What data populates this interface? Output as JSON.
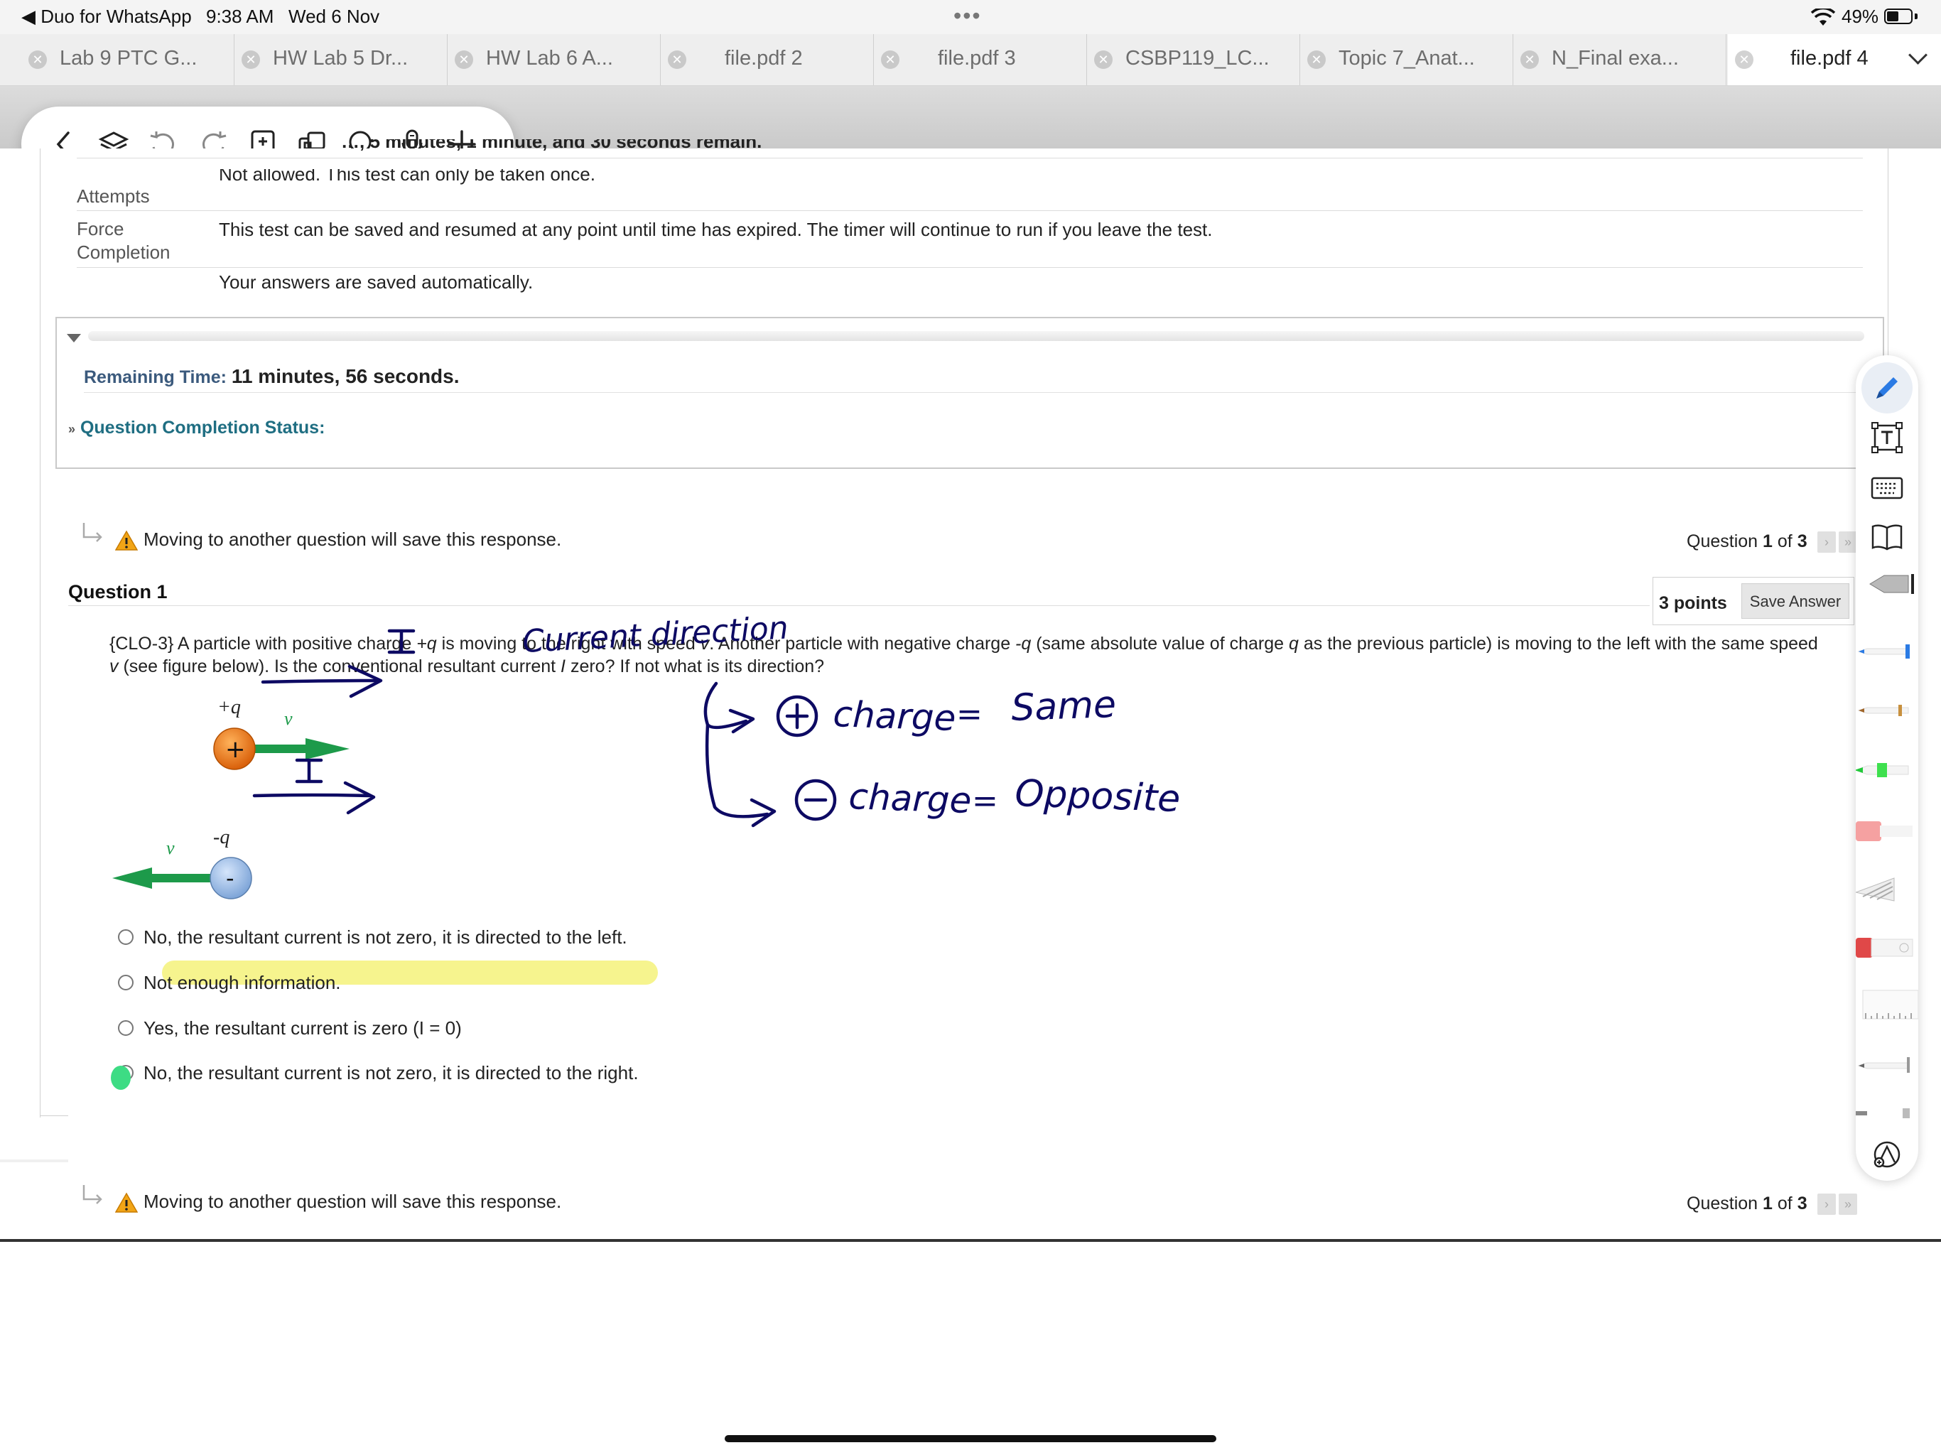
{
  "status_bar": {
    "back_app": "◀ Duo for WhatsApp",
    "time": "9:38 AM",
    "date": "Wed 6 Nov",
    "dots": "•••",
    "battery_pct": "49%",
    "battery_level": 0.49
  },
  "tabs": [
    {
      "label": "Lab 9 PTC G..."
    },
    {
      "label": "HW Lab 5 Dr..."
    },
    {
      "label": "HW Lab 6 A..."
    },
    {
      "label": "file.pdf 2"
    },
    {
      "label": "file.pdf 3"
    },
    {
      "label": "CSBP119_LC..."
    },
    {
      "label": "Topic 7_Anat..."
    },
    {
      "label": "N_Final exa..."
    },
    {
      "label": "file.pdf 4",
      "active": true
    }
  ],
  "floating_toolbar": {
    "icons": [
      "back-icon",
      "layers-icon",
      "undo-icon",
      "redo-icon",
      "page-add-icon",
      "copy-icon",
      "search-icon",
      "microphone-icon",
      "plus-icon"
    ]
  },
  "test_info": {
    "partial_text": "…, 5 minutes, 1 minute, and 30 seconds remain.",
    "multiple_attempts_label": "Attempts",
    "multiple_attempts_value": "Not allowed. This test can only be taken once.",
    "force_completion_label": "Force Completion",
    "force_completion_value": "This test can be saved and resumed at any point until time has expired. The timer will continue to run if you leave the test.",
    "autosave_value": "Your answers are saved automatically."
  },
  "timer": {
    "label": "Remaining Time:",
    "value": "11 minutes, 56 seconds.",
    "completion_status": "Question Completion Status:"
  },
  "navigation": {
    "warning": "Moving to another question will save this response.",
    "question_word": "Question",
    "current": "1",
    "of_word": "of",
    "total": "3"
  },
  "question": {
    "heading": "Question 1",
    "points": "3 points",
    "save_label": "Save Answer",
    "text_part1": "{CLO-3} A particle with positive charge ",
    "text_q_pos": "+q",
    "text_part2": " is moving to the right with speed ",
    "text_v": "v",
    "text_part3": ". Another particle with negative charge ",
    "text_q_neg": "-q",
    "text_part4": " (same absolute value of charge ",
    "text_q": "q",
    "text_part5": " as the previous particle) is moving to the left with the same speed ",
    "text_v2": "v",
    "text_part6": " (see figure below). Is the conventional resultant current ",
    "text_i": "I",
    "text_part7": " zero? If not what is its direction?",
    "figure": {
      "pos_label": "+q",
      "neg_label": "-q",
      "vector_label": "v⃗",
      "pos_symbol": "+",
      "neg_symbol": "-",
      "arrow_color": "#1d9a4a",
      "pos_color": "#e8730f",
      "neg_color": "#8fb4e3"
    },
    "options": [
      {
        "label": "No, the resultant current is not zero, it is directed to the left."
      },
      {
        "label": "Not enough information."
      },
      {
        "label": "Yes, the resultant current is zero (I = 0)"
      },
      {
        "label": "No, the resultant current is not zero, it is directed to the right."
      }
    ]
  },
  "handwriting": {
    "current_direction": "Current direction",
    "i_symbol": "I",
    "pos_charge": "charge",
    "pos_equals": "=",
    "pos_result": "Same",
    "neg_charge": "charge",
    "neg_equals": "=",
    "neg_result": "Opposite",
    "ink_color": "#0d0a63",
    "highlight_color": "#f4f27a",
    "marker_color": "#3ddc84"
  },
  "tool_rail": {
    "icons": [
      "pen-icon",
      "text-box-icon",
      "keyboard-icon",
      "book-icon",
      "fountain-pen-tool",
      "blue-pen-tool",
      "brown-pencil-tool",
      "green-highlighter-tool",
      "eraser-tool",
      "pattern-tool",
      "red-marker-tool",
      "ruler-tool",
      "pencil-tool",
      "lasso-tool",
      "color-picker-icon"
    ]
  }
}
